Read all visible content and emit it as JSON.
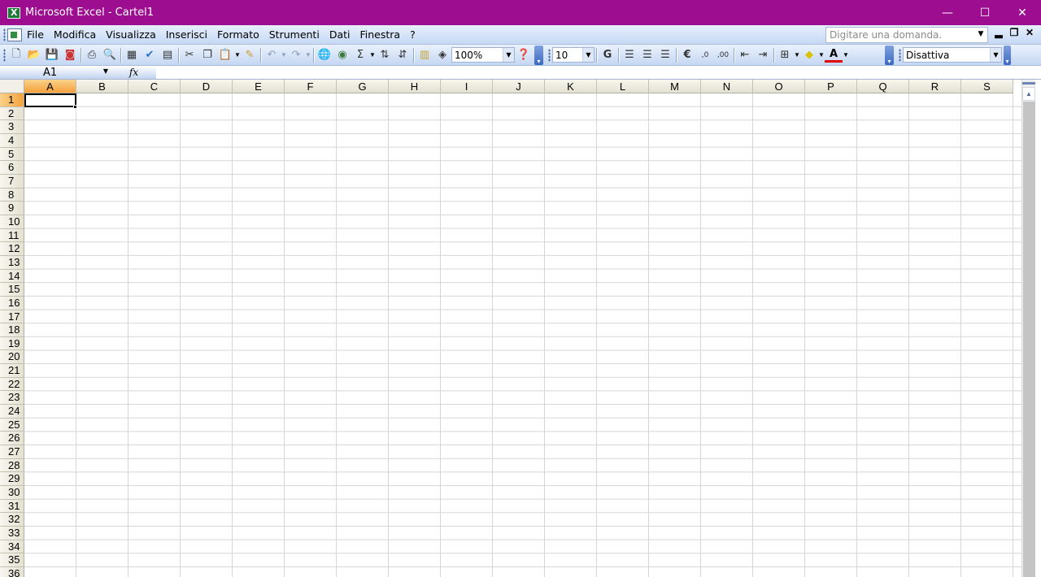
{
  "window": {
    "title": "Microsoft Excel - Cartel1",
    "minimize": "—",
    "maximize": "☐",
    "close": "✕"
  },
  "menu": {
    "items": [
      {
        "label": "File"
      },
      {
        "label": "Modifica"
      },
      {
        "label": "Visualizza"
      },
      {
        "label": "Inserisci"
      },
      {
        "label": "Formato"
      },
      {
        "label": "Strumenti"
      },
      {
        "label": "Dati"
      },
      {
        "label": "Finestra"
      },
      {
        "label": "?"
      }
    ],
    "ask_placeholder": "Digitare una domanda.",
    "doc_minimize": "▂",
    "doc_restore": "❐",
    "doc_close": "✕"
  },
  "toolbar": {
    "zoom": "100%",
    "font_size": "10",
    "bold": "G",
    "currency": "€",
    "style": "Disattiva",
    "sum": "Σ",
    "font_color_letter": "A"
  },
  "formula_bar": {
    "cell_ref": "A1",
    "fx": "fx",
    "formula": ""
  },
  "sheet": {
    "columns": [
      "A",
      "B",
      "C",
      "D",
      "E",
      "F",
      "G",
      "H",
      "I",
      "J",
      "K",
      "L",
      "M",
      "N",
      "O",
      "P",
      "Q",
      "R",
      "S"
    ],
    "rows": [
      "1",
      "2",
      "3",
      "4",
      "5",
      "6",
      "7",
      "8",
      "9",
      "10",
      "11",
      "12",
      "13",
      "14",
      "15",
      "16",
      "17",
      "18",
      "19",
      "20",
      "21",
      "22",
      "23",
      "24",
      "25",
      "26",
      "27",
      "28",
      "29",
      "30",
      "31",
      "32",
      "33",
      "34",
      "35",
      "36"
    ],
    "active_col": "A",
    "active_row": "1"
  },
  "colors": {
    "titlebar": "#9c0e8f",
    "active_header": "#f4a13c"
  }
}
